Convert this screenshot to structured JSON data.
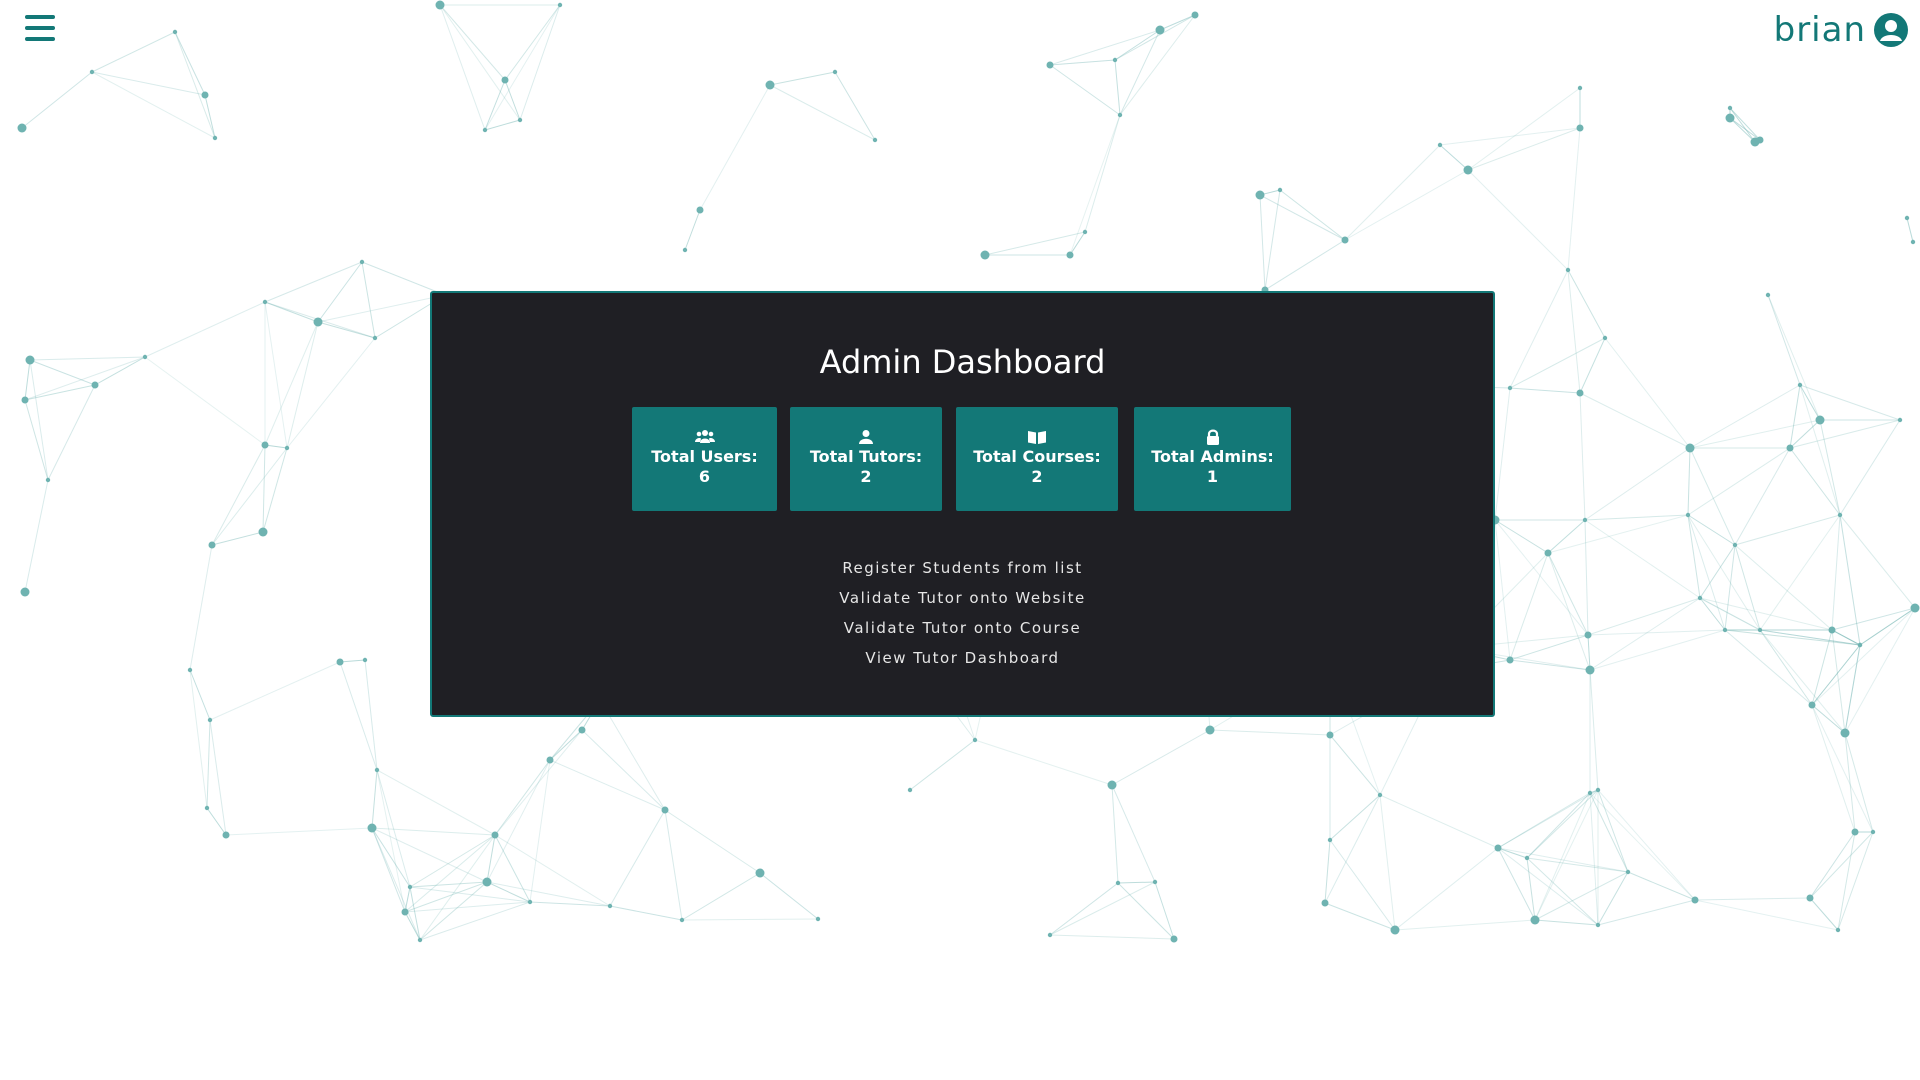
{
  "header": {
    "username": "brian"
  },
  "dashboard": {
    "title": "Admin Dashboard",
    "stats": [
      {
        "label": "Total Users:",
        "value": "6",
        "icon": "users-icon"
      },
      {
        "label": "Total Tutors:",
        "value": "2",
        "icon": "user-icon"
      },
      {
        "label": "Total Courses:",
        "value": "2",
        "icon": "book-icon"
      },
      {
        "label": "Total Admins:",
        "value": "1",
        "icon": "lock-icon"
      }
    ],
    "links": [
      "Register Students from list",
      "Validate Tutor onto Website",
      "Validate Tutor onto Course",
      "View Tutor Dashboard"
    ]
  },
  "colors": {
    "accent": "#137877",
    "panel_bg": "#1f1f24",
    "network": "#6fb3b1"
  }
}
